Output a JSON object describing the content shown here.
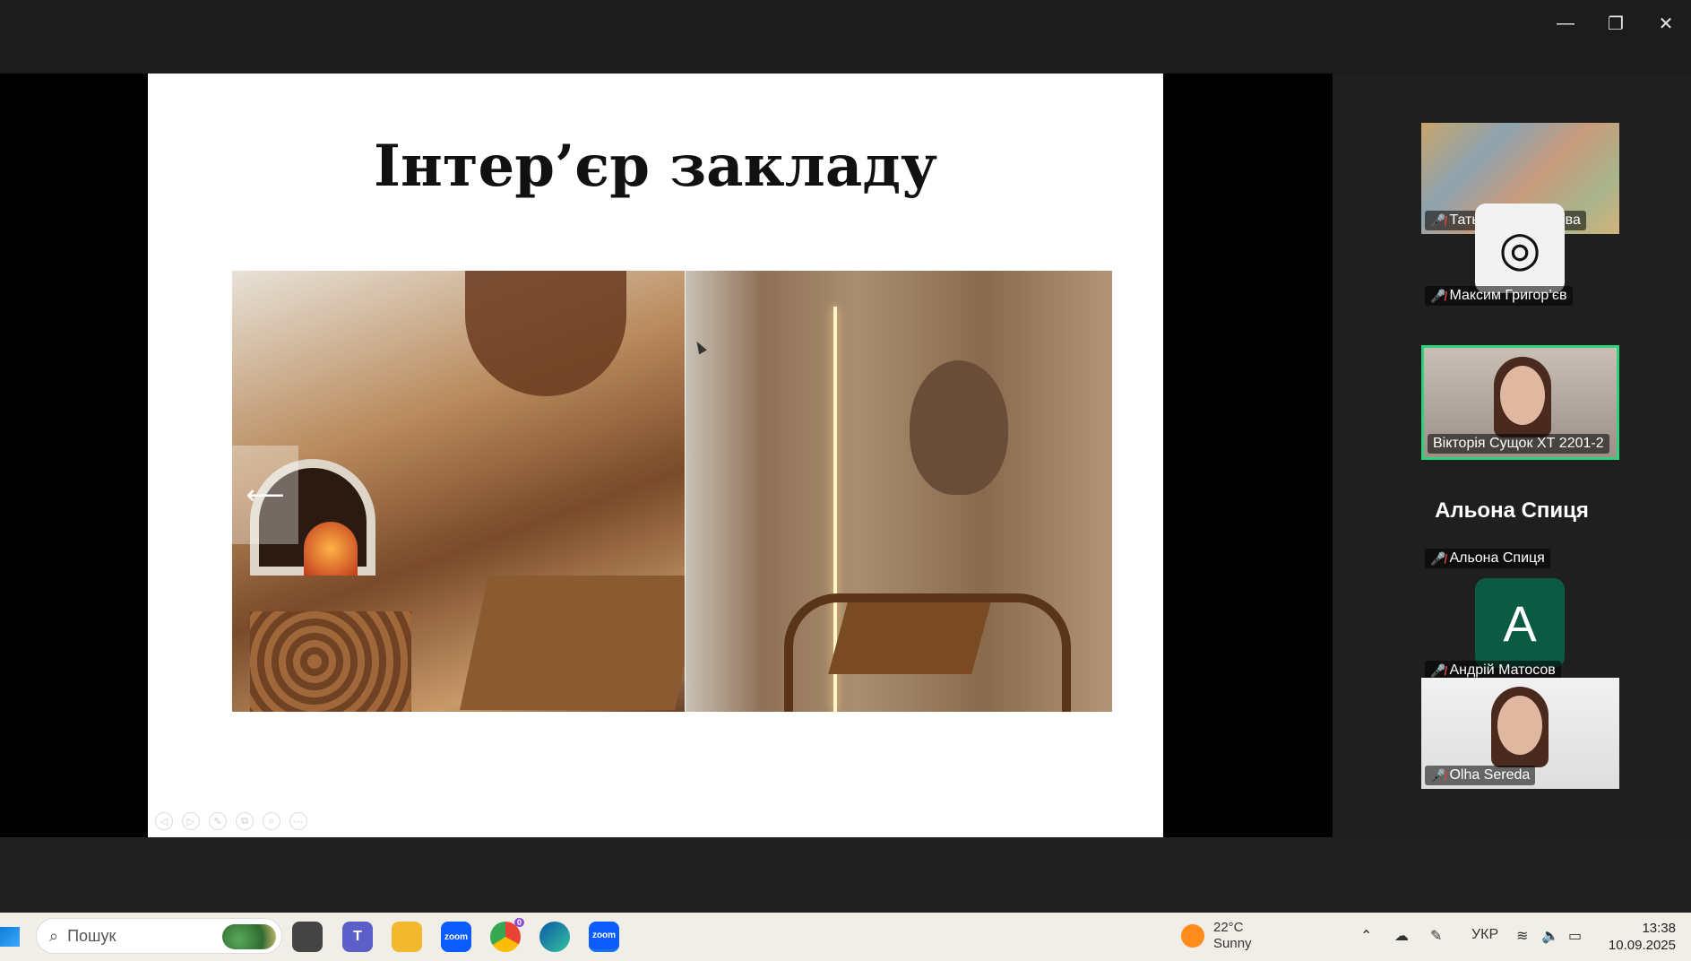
{
  "window_controls": {
    "minimize": "—",
    "restore": "❐",
    "close": "✕"
  },
  "slide": {
    "title": "Інтер’єр закладу",
    "nav_arrow": "⟵",
    "toolbar": [
      "◁",
      "▷",
      "✎",
      "⧉",
      "⌕",
      "⋯"
    ]
  },
  "participants": [
    {
      "name": "Татьяна Маренкова",
      "muted": true,
      "kind": "video",
      "active": false
    },
    {
      "name": "Максим Григор’єв",
      "muted": true,
      "kind": "avatar",
      "active": false
    },
    {
      "name": "Вікторія Сущок ХТ 2201-2",
      "muted": false,
      "kind": "video",
      "active": true
    },
    {
      "name": "Альона Спиця",
      "muted": true,
      "kind": "name-only",
      "active": false,
      "big_name": "Альона Спиця"
    },
    {
      "name": "Андрій Матосов",
      "muted": true,
      "kind": "avatar",
      "initial": "A",
      "active": false
    },
    {
      "name": "Olha Sereda",
      "muted": true,
      "kind": "video",
      "active": false
    }
  ],
  "icons": {
    "mic_off": "mic-off-icon"
  },
  "taskbar": {
    "search_placeholder": "Пошук",
    "apps": [
      {
        "name": "task-view",
        "label": ""
      },
      {
        "name": "teams",
        "label": "T"
      },
      {
        "name": "file-explorer",
        "label": ""
      },
      {
        "name": "zoom-1",
        "label": "zoom"
      },
      {
        "name": "chrome",
        "label": "",
        "badge": "0"
      },
      {
        "name": "edge",
        "label": ""
      },
      {
        "name": "zoom-2",
        "label": "zoom"
      }
    ],
    "weather": {
      "temp": "22°C",
      "condition": "Sunny"
    },
    "language": "УКР",
    "time": "13:38",
    "date": "10.09.2025"
  },
  "colors": {
    "active_border": "#2fd27a",
    "mic_off": "#e8423f",
    "avatar_a_bg": "#0b5a43"
  }
}
